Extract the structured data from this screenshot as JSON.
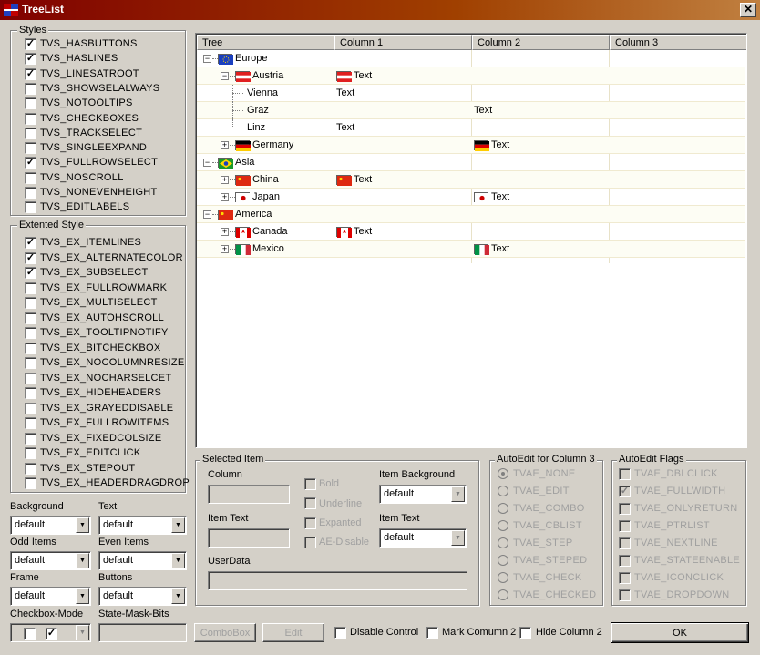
{
  "window": {
    "title": "TreeList",
    "close_glyph": "✕"
  },
  "styles": {
    "label": "Styles",
    "items": [
      {
        "label": "TVS_HASBUTTONS",
        "checked": true
      },
      {
        "label": "TVS_HASLINES",
        "checked": true
      },
      {
        "label": "TVS_LINESATROOT",
        "checked": true
      },
      {
        "label": "TVS_SHOWSELALWAYS",
        "checked": false
      },
      {
        "label": "TVS_NOTOOLTIPS",
        "checked": false
      },
      {
        "label": "TVS_CHECKBOXES",
        "checked": false
      },
      {
        "label": "TVS_TRACKSELECT",
        "checked": false
      },
      {
        "label": "TVS_SINGLEEXPAND",
        "checked": false
      },
      {
        "label": "TVS_FULLROWSELECT",
        "checked": true
      },
      {
        "label": "TVS_NOSCROLL",
        "checked": false
      },
      {
        "label": "TVS_NONEVENHEIGHT",
        "checked": false
      },
      {
        "label": "TVS_EDITLABELS",
        "checked": false
      }
    ]
  },
  "extended": {
    "label": "Extented Style",
    "items": [
      {
        "label": "TVS_EX_ITEMLINES",
        "checked": true
      },
      {
        "label": "TVS_EX_ALTERNATECOLOR",
        "checked": true
      },
      {
        "label": "TVS_EX_SUBSELECT",
        "checked": true
      },
      {
        "label": "TVS_EX_FULLROWMARK",
        "checked": false
      },
      {
        "label": "TVS_EX_MULTISELECT",
        "checked": false
      },
      {
        "label": "TVS_EX_AUTOHSCROLL",
        "checked": false
      },
      {
        "label": "TVS_EX_TOOLTIPNOTIFY",
        "checked": false
      },
      {
        "label": "TVS_EX_BITCHECKBOX",
        "checked": false
      },
      {
        "label": "TVS_EX_NOCOLUMNRESIZE",
        "checked": false
      },
      {
        "label": "TVS_EX_NOCHARSELCET",
        "checked": false
      },
      {
        "label": "TVS_EX_HIDEHEADERS",
        "checked": false
      },
      {
        "label": "TVS_EX_GRAYEDDISABLE",
        "checked": false
      },
      {
        "label": "TVS_EX_FULLROWITEMS",
        "checked": false
      },
      {
        "label": "TVS_EX_FIXEDCOLSIZE",
        "checked": false
      },
      {
        "label": "TVS_EX_EDITCLICK",
        "checked": false
      },
      {
        "label": "TVS_EX_STEPOUT",
        "checked": false
      },
      {
        "label": "TVS_EX_HEADERDRAGDROP",
        "checked": false
      }
    ]
  },
  "color_settings": {
    "background_label": "Background",
    "background_value": "default",
    "text_label": "Text",
    "text_value": "default",
    "odd_label": "Odd Items",
    "odd_value": "default",
    "even_label": "Even Items",
    "even_value": "default",
    "frame_label": "Frame",
    "frame_value": "default",
    "buttons_label": "Buttons",
    "buttons_value": "default",
    "checkbox_mode_label": "Checkbox-Mode",
    "state_mask_label": "State-Mask-Bits",
    "checkbox_mode_checks": [
      false,
      true
    ]
  },
  "tree": {
    "headers": [
      "Tree",
      "Column 1",
      "Column 2",
      "Column 3"
    ],
    "rows": [
      {
        "label": "Europe",
        "level": 0,
        "expander": "−",
        "flag": "eu",
        "c1": "",
        "c1flag": "",
        "c2": "",
        "c2flag": ""
      },
      {
        "label": "Austria",
        "level": 1,
        "expander": "−",
        "flag": "at",
        "c1": "Text",
        "c1flag": "at",
        "c2": "",
        "c2flag": ""
      },
      {
        "label": "Vienna",
        "level": 2,
        "expander": "",
        "flag": "",
        "c1": "Text",
        "c1flag": "",
        "c2": "",
        "c2flag": ""
      },
      {
        "label": "Graz",
        "level": 2,
        "expander": "",
        "flag": "",
        "c1": "",
        "c1flag": "",
        "c2": "Text",
        "c2flag": ""
      },
      {
        "label": "Linz",
        "level": 2,
        "expander": "",
        "flag": "",
        "c1": "Text",
        "c1flag": "",
        "c2": "",
        "c2flag": ""
      },
      {
        "label": "Germany",
        "level": 1,
        "expander": "+",
        "flag": "de",
        "c1": "",
        "c1flag": "",
        "c2": "Text",
        "c2flag": "de"
      },
      {
        "label": "Asia",
        "level": 0,
        "expander": "−",
        "flag": "br",
        "c1": "",
        "c1flag": "",
        "c2": "",
        "c2flag": ""
      },
      {
        "label": "China",
        "level": 1,
        "expander": "+",
        "flag": "cn",
        "c1": "Text",
        "c1flag": "cn",
        "c2": "",
        "c2flag": ""
      },
      {
        "label": "Japan",
        "level": 1,
        "expander": "+",
        "flag": "jp",
        "c1": "",
        "c1flag": "",
        "c2": "Text",
        "c2flag": "jp"
      },
      {
        "label": "America",
        "level": 0,
        "expander": "−",
        "flag": "cn",
        "c1": "",
        "c1flag": "",
        "c2": "",
        "c2flag": ""
      },
      {
        "label": "Canada",
        "level": 1,
        "expander": "+",
        "flag": "ca",
        "c1": "Text",
        "c1flag": "ca",
        "c2": "",
        "c2flag": ""
      },
      {
        "label": "Mexico",
        "level": 1,
        "expander": "+",
        "flag": "it",
        "c1": "",
        "c1flag": "",
        "c2": "Text",
        "c2flag": "it"
      }
    ]
  },
  "selected_item": {
    "label": "Selected Item",
    "column_label": "Column",
    "item_text_label": "Item Text",
    "userdata_label": "UserData",
    "bold_label": "Bold",
    "underline_label": "Underline",
    "expanded_label": "Expanted",
    "ae_disable_label": "AE-Disable",
    "item_background_label": "Item Background",
    "item_background_value": "default",
    "item_text_color_label": "Item Text",
    "item_text_color_value": "default"
  },
  "autoedit_col3": {
    "label": "AutoEdit for Column 3",
    "options": [
      "TVAE_NONE",
      "TVAE_EDIT",
      "TVAE_COMBO",
      "TVAE_CBLIST",
      "TVAE_STEP",
      "TVAE_STEPED",
      "TVAE_CHECK",
      "TVAE_CHECKED"
    ],
    "selected": 0
  },
  "autoedit_flags": {
    "label": "AutoEdit Flags",
    "options": [
      {
        "label": "TVAE_DBLCLICK",
        "checked": false
      },
      {
        "label": "TVAE_FULLWIDTH",
        "checked": true
      },
      {
        "label": "TVAE_ONLYRETURN",
        "checked": false
      },
      {
        "label": "TVAE_PTRLIST",
        "checked": false
      },
      {
        "label": "TVAE_NEXTLINE",
        "checked": false
      },
      {
        "label": "TVAE_STATEENABLE",
        "checked": false
      },
      {
        "label": "TVAE_ICONCLICK",
        "checked": false
      },
      {
        "label": "TVAE_DROPDOWN",
        "checked": false
      }
    ]
  },
  "bottom": {
    "combobox_label": "ComboBox",
    "edit_label": "Edit",
    "disable_control_label": "Disable Control",
    "mark_column2_label": "Mark Comumn 2",
    "hide_column2_label": "Hide Column 2",
    "ok_label": "OK"
  },
  "glyphs": {
    "check": "✓",
    "combo_arrow": "▼"
  }
}
